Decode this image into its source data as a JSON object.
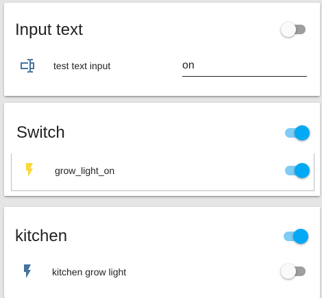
{
  "cards": [
    {
      "title": "Input text",
      "header_toggle_on": false,
      "row": {
        "icon": "textbox-icon",
        "label": "test text input",
        "input_value": "on"
      }
    },
    {
      "title": "Switch",
      "header_toggle_on": true,
      "row": {
        "icon": "flash-icon",
        "label": "grow_light_on",
        "toggle_on": true
      }
    },
    {
      "title": "kitchen",
      "header_toggle_on": true,
      "row": {
        "icon": "flash-icon",
        "label": "kitchen grow light",
        "toggle_on": false
      }
    }
  ],
  "colors": {
    "accent": "#03a9f4",
    "accent_track": "#7fccf5",
    "off_track": "#9e9e9e",
    "icon_blue": "#44739e",
    "icon_yellow": "#fdd835",
    "background": "#e5e5e5"
  }
}
